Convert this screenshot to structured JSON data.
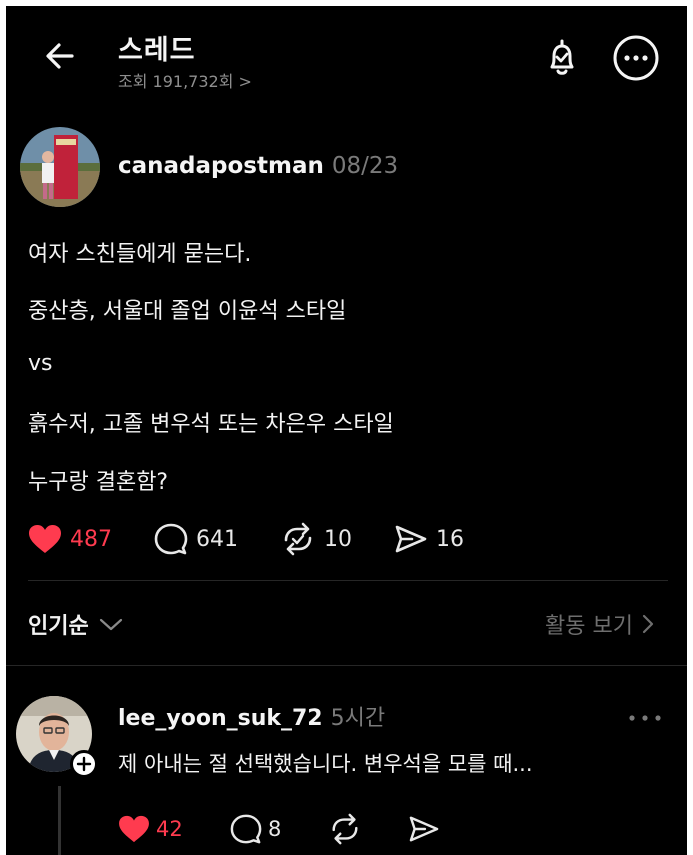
{
  "header": {
    "title": "스레드",
    "views_label": "조회 191,732회 >"
  },
  "post": {
    "username": "canadapostman",
    "time": "08/23",
    "lines": [
      "여자 스친들에게 묻는다.",
      "중산층, 서울대 졸업 이윤석 스타일",
      "vs",
      "흙수저, 고졸 변우석 또는 차은우 스타일",
      "누구랑 결혼함?"
    ],
    "likes": "487",
    "comments": "641",
    "reposts": "10",
    "shares": "16"
  },
  "sort": {
    "label": "인기순",
    "activity_label": "활동 보기"
  },
  "comment": {
    "username": "lee_yoon_suk_72",
    "time": "5시간",
    "text": "제 아내는 절 선택했습니다. 변우석을 모를 때...",
    "likes": "42",
    "comments": "8"
  },
  "colors": {
    "background": "#000000",
    "like_red": "#ff3b4f",
    "muted_text": "#7a7a7a"
  },
  "icons": [
    "back-arrow-icon",
    "bell-check-icon",
    "more-icon",
    "heart-icon",
    "comment-icon",
    "repost-icon",
    "share-icon",
    "chevron-down-icon",
    "chevron-right-icon",
    "plus-icon"
  ]
}
